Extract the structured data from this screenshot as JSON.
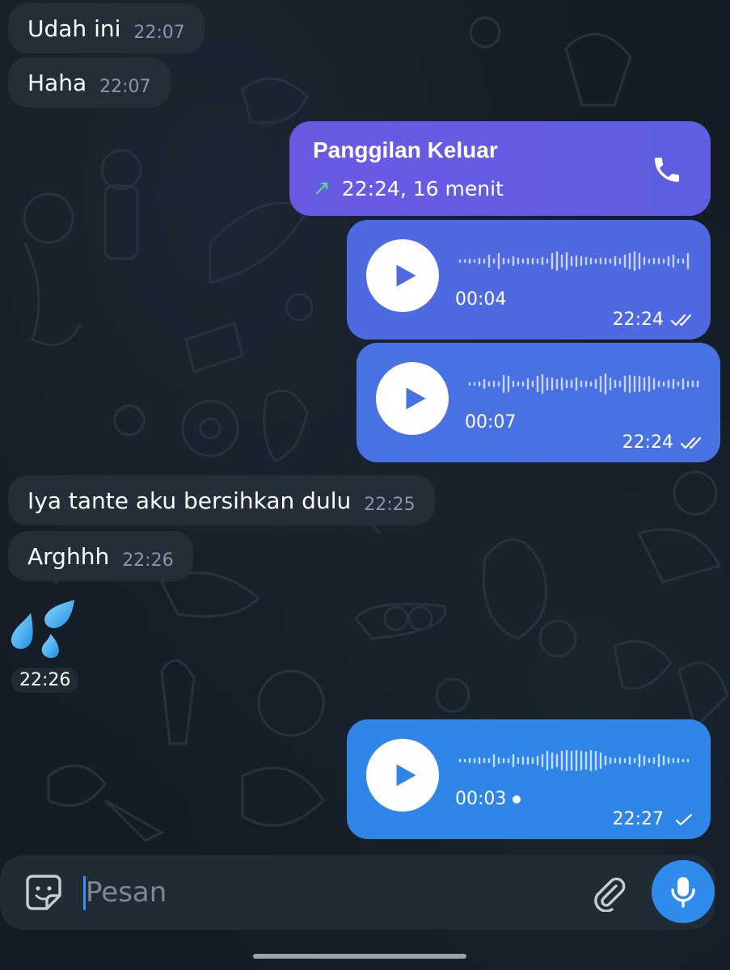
{
  "messages_in": [
    {
      "text": "Udah ini",
      "time": "22:07"
    },
    {
      "text": "Haha",
      "time": "22:07"
    },
    {
      "text": "Iya tante aku bersihkan dulu",
      "time": "22:25"
    },
    {
      "text": "Arghhh",
      "time": "22:26"
    }
  ],
  "call": {
    "title": "Panggilan Keluar",
    "detail": "22:24, 16 menit",
    "icon": "phone-icon",
    "direction_icon": "outgoing-arrow-icon"
  },
  "voice_messages": [
    {
      "duration": "00:04",
      "time": "22:24",
      "status": "read"
    },
    {
      "duration": "00:07",
      "time": "22:24",
      "status": "read"
    },
    {
      "duration": "00:03",
      "time": "22:27",
      "status": "sent",
      "unplayed": true
    }
  ],
  "emoji_message": {
    "emoji": "💦",
    "time": "22:26"
  },
  "composer": {
    "placeholder": "Pesan",
    "sticker_icon": "sticker-icon",
    "attach_icon": "paperclip-icon",
    "mic_icon": "microphone-icon"
  },
  "colors": {
    "background": "#141c25",
    "incoming_bubble": "#232e39",
    "call_bubble": "#6a59e3",
    "voice_bubble_1": "#4f6ae0",
    "voice_bubble_2": "#4872e2",
    "voice_bubble_3": "#2f86e6",
    "accent": "#2f8cea",
    "call_arrow": "#4ee08a"
  }
}
